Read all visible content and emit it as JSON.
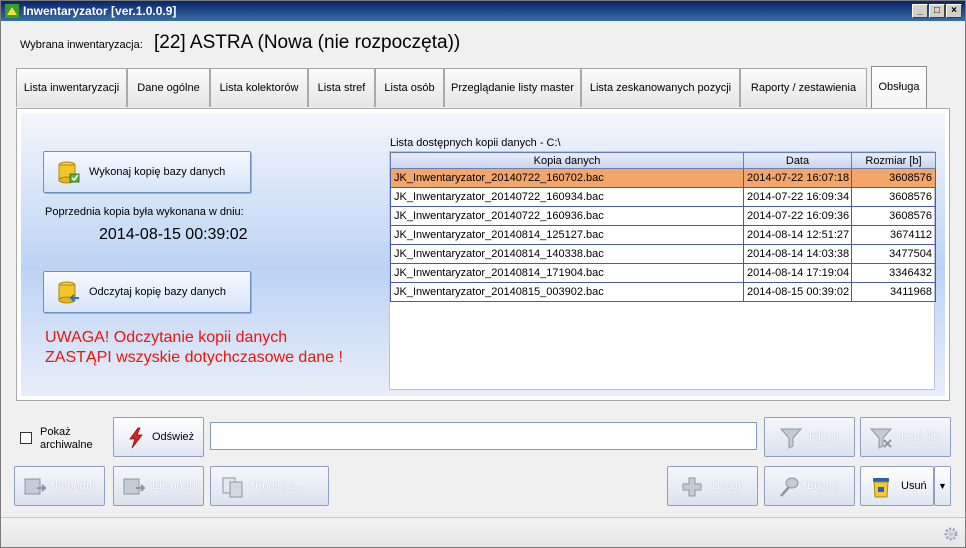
{
  "window": {
    "title": "Inwentaryzator [ver.1.0.0.9]",
    "minimize": "_",
    "maximize": "□",
    "close": "×"
  },
  "header": {
    "label": "Wybrana inwentaryzacja:",
    "value": "[22] ASTRA (Nowa (nie rozpoczęta))"
  },
  "tabs": [
    {
      "label": "Lista inwentaryzacji"
    },
    {
      "label": "Dane ogólne"
    },
    {
      "label": "Lista kolektorów"
    },
    {
      "label": "Lista stref"
    },
    {
      "label": "Lista osób"
    },
    {
      "label": "Przeglądanie listy master"
    },
    {
      "label": "Lista zeskanowanych pozycji"
    },
    {
      "label": "Raporty / zestawienia"
    },
    {
      "label": "Obsługa",
      "active": true
    }
  ],
  "backup": {
    "make_button": "Wykonaj kopię bazy danych",
    "prev_label": "Poprzednia kopia była wykonana w dniu:",
    "prev_date": "2014-08-15 00:39:02",
    "restore_button": "Odczytaj kopię bazy danych",
    "warning_line1": "UWAGA! Odczytanie kopii danych",
    "warning_line2": "ZASTĄPI wszyskie dotychczasowe dane !"
  },
  "list": {
    "caption": "Lista dostępnych kopii danych - C:\\",
    "columns": [
      "Kopia danych",
      "Data",
      "Rozmiar [b]"
    ],
    "rows": [
      {
        "name": "JK_Inwentaryzator_20140722_160702.bac",
        "date": "2014-07-22 16:07:18",
        "size": "3608576",
        "selected": true
      },
      {
        "name": "JK_Inwentaryzator_20140722_160934.bac",
        "date": "2014-07-22 16:09:34",
        "size": "3608576"
      },
      {
        "name": "JK_Inwentaryzator_20140722_160936.bac",
        "date": "2014-07-22 16:09:36",
        "size": "3608576"
      },
      {
        "name": "JK_Inwentaryzator_20140814_125127.bac",
        "date": "2014-08-14 12:51:27",
        "size": "3674112"
      },
      {
        "name": "JK_Inwentaryzator_20140814_140338.bac",
        "date": "2014-08-14 14:03:38",
        "size": "3477504"
      },
      {
        "name": "JK_Inwentaryzator_20140814_171904.bac",
        "date": "2014-08-14 17:19:04",
        "size": "3346432"
      },
      {
        "name": "JK_Inwentaryzator_20140815_003902.bac",
        "date": "2014-08-15 00:39:02",
        "size": "3411968"
      }
    ]
  },
  "toolbar": {
    "show_archived_line1": "Pokaż",
    "show_archived_line2": "archiwalne",
    "refresh": "Odśwież",
    "search_value": "",
    "filter": "Filtruj",
    "clear_filter": "Ksuj filtr",
    "import": "Importuj",
    "export": "Eksportuj",
    "copy_from": "Kopiuj z ...",
    "add": "Dodaj",
    "edit": "Edytuj",
    "delete": "Usuń",
    "dropdown_arrow": "▼"
  },
  "colors": {
    "selected_row": "#f3a56a",
    "warning_text": "#e8160c",
    "refresh_icon": "#e02020"
  }
}
